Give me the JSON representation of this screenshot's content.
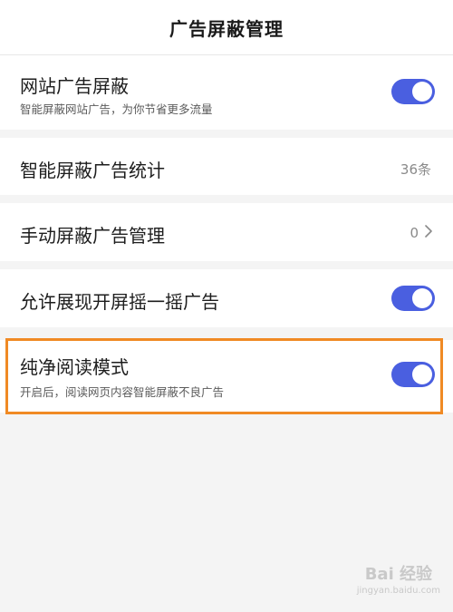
{
  "header": {
    "title": "广告屏蔽管理"
  },
  "colors": {
    "toggle_on": "#4a5fe0",
    "highlight": "#f08a24"
  },
  "rows": {
    "website_ad_block": {
      "label": "网站广告屏蔽",
      "sub": "智能屏蔽网站广告，为你节省更多流量",
      "toggle": "on"
    },
    "smart_stats": {
      "label": "智能屏蔽广告统计",
      "value": "36条"
    },
    "manual_block": {
      "label": "手动屏蔽广告管理",
      "value": "0"
    },
    "splash_shake": {
      "label": "允许展现开屏摇一摇广告",
      "toggle": "on"
    },
    "pure_reading": {
      "label": "纯净阅读模式",
      "sub": "开启后，阅读网页内容智能屏蔽不良广告",
      "toggle": "on"
    }
  },
  "watermark": {
    "text": "Bai 经验",
    "url": "jingyan.baidu.com"
  }
}
